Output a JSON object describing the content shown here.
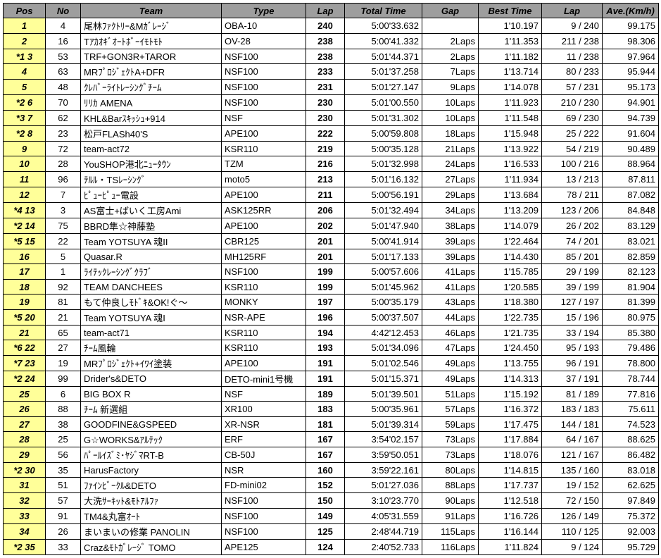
{
  "headers": {
    "pos": "Pos",
    "no": "No",
    "team": "Team",
    "type": "Type",
    "lap": "Lap",
    "total_time": "Total Time",
    "gap": "Gap",
    "best_time": "Best Time",
    "best_lap": "Lap",
    "ave": "Ave.(Km/h)"
  },
  "rows": [
    {
      "pos": "1",
      "no": "4",
      "team": "尾林ﾌｧｸﾄﾘｰ&Mｶﾞﾚｰｼﾞ",
      "type": "OBA-10",
      "lap": "240",
      "total": "5:00'33.632",
      "gap": "",
      "best": "1'10.197",
      "blap": "9 / 240",
      "ave": "99.175"
    },
    {
      "pos": "2",
      "no": "16",
      "team": "Tｱｶｵｷﾞｵｰﾄﾎﾞｰｲﾓﾄﾓﾄ",
      "type": "OV-28",
      "lap": "238",
      "total": "5:00'41.332",
      "gap": "2Laps",
      "best": "1'11.353",
      "blap": "211 / 238",
      "ave": "98.306"
    },
    {
      "pos": "*1  3",
      "no": "53",
      "team": "TRF+GON3R+TAROR",
      "type": "NSF100",
      "lap": "238",
      "total": "5:01'44.371",
      "gap": "2Laps",
      "best": "1'11.182",
      "blap": "11 / 238",
      "ave": "97.964"
    },
    {
      "pos": "4",
      "no": "63",
      "team": "MRﾌﾟﾛｼﾞｪｸﾄA+DFR",
      "type": "NSF100",
      "lap": "233",
      "total": "5:01'37.258",
      "gap": "7Laps",
      "best": "1'13.714",
      "blap": "80 / 233",
      "ave": "95.944"
    },
    {
      "pos": "5",
      "no": "48",
      "team": "ｸﾚﾊﾞｰﾗｲﾄﾚｰｼﾝｸﾞﾁｰﾑ",
      "type": "NSF100",
      "lap": "231",
      "total": "5:01'27.147",
      "gap": "9Laps",
      "best": "1'14.078",
      "blap": "57 / 231",
      "ave": "95.173"
    },
    {
      "pos": "*2  6",
      "no": "70",
      "team": "ﾘﾘｶ  AMENA",
      "type": "NSF100",
      "lap": "230",
      "total": "5:01'00.550",
      "gap": "10Laps",
      "best": "1'11.923",
      "blap": "210 / 230",
      "ave": "94.901"
    },
    {
      "pos": "*3  7",
      "no": "62",
      "team": "KHL&Barｽｷｯｼｭ+914",
      "type": "NSF",
      "lap": "230",
      "total": "5:01'31.302",
      "gap": "10Laps",
      "best": "1'11.548",
      "blap": "69 / 230",
      "ave": "94.739"
    },
    {
      "pos": "*2  8",
      "no": "23",
      "team": "松戸FLASh40'S",
      "type": "APE100",
      "lap": "222",
      "total": "5:00'59.808",
      "gap": "18Laps",
      "best": "1'15.948",
      "blap": "25 / 222",
      "ave": "91.604"
    },
    {
      "pos": "9",
      "no": "72",
      "team": "team-act72",
      "type": "KSR110",
      "lap": "219",
      "total": "5:00'35.128",
      "gap": "21Laps",
      "best": "1'13.922",
      "blap": "54 / 219",
      "ave": "90.489"
    },
    {
      "pos": "10",
      "no": "28",
      "team": "YouSHOP港北ﾆｭｰﾀｳﾝ",
      "type": "TZM",
      "lap": "216",
      "total": "5:01'32.998",
      "gap": "24Laps",
      "best": "1'16.533",
      "blap": "100 / 216",
      "ave": "88.964"
    },
    {
      "pos": "11",
      "no": "96",
      "team": "ﾃﾙﾙ・TSﾚｰｼﾝｸﾞ",
      "type": "moto5",
      "lap": "213",
      "total": "5:01'16.132",
      "gap": "27Laps",
      "best": "1'11.934",
      "blap": "13 / 213",
      "ave": "87.811"
    },
    {
      "pos": "12",
      "no": "7",
      "team": "ﾋﾟｭｰﾋﾟｭｰ電設",
      "type": "APE100",
      "lap": "211",
      "total": "5:00'56.191",
      "gap": "29Laps",
      "best": "1'13.684",
      "blap": "78 / 211",
      "ave": "87.082"
    },
    {
      "pos": "*4 13",
      "no": "3",
      "team": "AS富士+ばいく工房Ami",
      "type": "ASK125RR",
      "lap": "206",
      "total": "5:01'32.494",
      "gap": "34Laps",
      "best": "1'13.209",
      "blap": "123 / 206",
      "ave": "84.848"
    },
    {
      "pos": "*2 14",
      "no": "75",
      "team": "BBRD隼☆神藤塾",
      "type": "APE100",
      "lap": "202",
      "total": "5:01'47.940",
      "gap": "38Laps",
      "best": "1'14.079",
      "blap": "26 / 202",
      "ave": "83.129"
    },
    {
      "pos": "*5 15",
      "no": "22",
      "team": "Team YOTSUYA 魂II",
      "type": "CBR125",
      "lap": "201",
      "total": "5:00'41.914",
      "gap": "39Laps",
      "best": "1'22.464",
      "blap": "74 / 201",
      "ave": "83.021"
    },
    {
      "pos": "16",
      "no": "5",
      "team": "Quasar.R",
      "type": "MH125RF",
      "lap": "201",
      "total": "5:01'17.133",
      "gap": "39Laps",
      "best": "1'14.430",
      "blap": "85 / 201",
      "ave": "82.859"
    },
    {
      "pos": "17",
      "no": "1",
      "team": "ﾗｲﾃｯｸﾚｰｼﾝｸﾞｸﾗﾌﾞ",
      "type": "NSF100",
      "lap": "199",
      "total": "5:00'57.606",
      "gap": "41Laps",
      "best": "1'15.785",
      "blap": "29 / 199",
      "ave": "82.123"
    },
    {
      "pos": "18",
      "no": "92",
      "team": "TEAM DANCHEES",
      "type": "KSR110",
      "lap": "199",
      "total": "5:01'45.962",
      "gap": "41Laps",
      "best": "1'20.585",
      "blap": "39 / 199",
      "ave": "81.904"
    },
    {
      "pos": "19",
      "no": "81",
      "team": "もて仲良しﾓﾄﾞｷ&OK!ぐ～",
      "type": "MONKY",
      "lap": "197",
      "total": "5:00'35.179",
      "gap": "43Laps",
      "best": "1'18.380",
      "blap": "127 / 197",
      "ave": "81.399"
    },
    {
      "pos": "*5 20",
      "no": "21",
      "team": "Team YOTSUYA 魂I",
      "type": "NSR-APE",
      "lap": "196",
      "total": "5:00'37.507",
      "gap": "44Laps",
      "best": "1'22.735",
      "blap": "15 / 196",
      "ave": "80.975"
    },
    {
      "pos": "21",
      "no": "65",
      "team": "team-act71",
      "type": "KSR110",
      "lap": "194",
      "total": "4:42'12.453",
      "gap": "46Laps",
      "best": "1'21.735",
      "blap": "33 / 194",
      "ave": "85.380"
    },
    {
      "pos": "*6 22",
      "no": "27",
      "team": "ﾁｰﾑ風輪",
      "type": "KSR110",
      "lap": "193",
      "total": "5:01'34.096",
      "gap": "47Laps",
      "best": "1'24.450",
      "blap": "95 / 193",
      "ave": "79.486"
    },
    {
      "pos": "*7 23",
      "no": "19",
      "team": "MRﾌﾟﾛｼﾞｪｸﾄ+ｲﾜｲ塗装",
      "type": "APE100",
      "lap": "191",
      "total": "5:01'02.546",
      "gap": "49Laps",
      "best": "1'13.755",
      "blap": "96 / 191",
      "ave": "78.800"
    },
    {
      "pos": "*2 24",
      "no": "99",
      "team": "Drider's&DETO",
      "type": "DETO-mini1号機",
      "lap": "191",
      "total": "5:01'15.371",
      "gap": "49Laps",
      "best": "1'14.313",
      "blap": "37 / 191",
      "ave": "78.744"
    },
    {
      "pos": "25",
      "no": "6",
      "team": "BIG BOX  R",
      "type": "NSF",
      "lap": "189",
      "total": "5:01'39.501",
      "gap": "51Laps",
      "best": "1'15.192",
      "blap": "81 / 189",
      "ave": "77.816"
    },
    {
      "pos": "26",
      "no": "88",
      "team": "ﾁｰﾑ 新選組",
      "type": "XR100",
      "lap": "183",
      "total": "5:00'35.961",
      "gap": "57Laps",
      "best": "1'16.372",
      "blap": "183 / 183",
      "ave": "75.611"
    },
    {
      "pos": "27",
      "no": "38",
      "team": "GOODFINE&GSPEED",
      "type": "XR-NSR",
      "lap": "181",
      "total": "5:01'39.314",
      "gap": "59Laps",
      "best": "1'17.475",
      "blap": "144 / 181",
      "ave": "74.523"
    },
    {
      "pos": "28",
      "no": "25",
      "team": "G☆WORKS&ｱﾙﾃｯｸ",
      "type": "ERF",
      "lap": "167",
      "total": "3:54'02.157",
      "gap": "73Laps",
      "best": "1'17.884",
      "blap": "64 / 167",
      "ave": "88.625"
    },
    {
      "pos": "29",
      "no": "56",
      "team": "ﾊﾟｰﾙｲｽﾞﾐ･ﾔｼﾞﾏRT-B",
      "type": "CB-50J",
      "lap": "167",
      "total": "3:59'50.051",
      "gap": "73Laps",
      "best": "1'18.076",
      "blap": "121 / 167",
      "ave": "86.482"
    },
    {
      "pos": "*2 30",
      "no": "35",
      "team": "HarusFactory",
      "type": "NSR",
      "lap": "160",
      "total": "3:59'22.161",
      "gap": "80Laps",
      "best": "1'14.815",
      "blap": "135 / 160",
      "ave": "83.018"
    },
    {
      "pos": "31",
      "no": "51",
      "team": "ﾌｧｲﾝﾋﾞｰｸﾙ&DETO",
      "type": "FD-mini02",
      "lap": "152",
      "total": "5:01'27.036",
      "gap": "88Laps",
      "best": "1'17.737",
      "blap": "19 / 152",
      "ave": "62.625"
    },
    {
      "pos": "32",
      "no": "57",
      "team": "大洗ｻｰｷｯﾄ&ﾓﾄｱﾙﾌｧ",
      "type": "NSF100",
      "lap": "150",
      "total": "3:10'23.770",
      "gap": "90Laps",
      "best": "1'12.518",
      "blap": "72 / 150",
      "ave": "97.849"
    },
    {
      "pos": "33",
      "no": "91",
      "team": "TM4&丸富ｵｰﾄ",
      "type": "NSF100",
      "lap": "149",
      "total": "4:05'31.559",
      "gap": "91Laps",
      "best": "1'16.726",
      "blap": "126 / 149",
      "ave": "75.372"
    },
    {
      "pos": "34",
      "no": "26",
      "team": "まいまいの修業 PANOLIN",
      "type": "NSF100",
      "lap": "125",
      "total": "2:48'44.719",
      "gap": "115Laps",
      "best": "1'16.144",
      "blap": "110 / 125",
      "ave": "92.003"
    },
    {
      "pos": "*2 35",
      "no": "33",
      "team": "Craz&ﾓﾄｶﾞﾚｰｼﾞ TOMO",
      "type": "APE125",
      "lap": "124",
      "total": "2:40'52.733",
      "gap": "116Laps",
      "best": "1'11.824",
      "blap": "9 / 124",
      "ave": "95.729"
    }
  ]
}
